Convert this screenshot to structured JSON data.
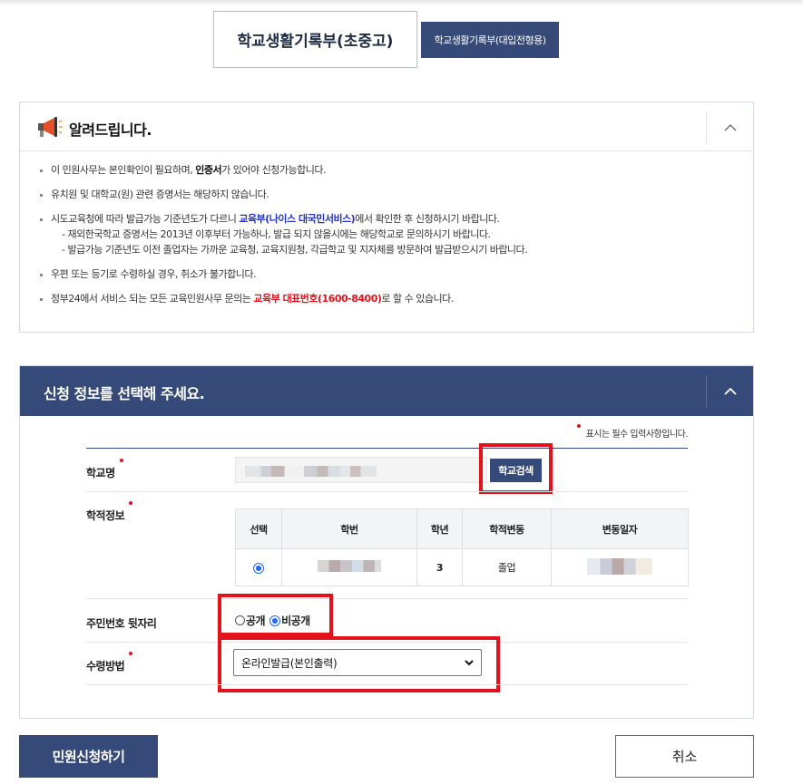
{
  "tabs": {
    "active": "학교생활기록부(초중고)",
    "inactive": "학교생활기록부(대입전형용)"
  },
  "notice": {
    "title": "알려드립니다.",
    "items": [
      {
        "pre": "이 민원사무는 본인확인이 필요하며, ",
        "em": "인증서",
        "post": "가 있어야 신청가능합니다."
      },
      {
        "text": "유치원 및 대학교(원) 관련 증명서는 해당하지 않습니다."
      },
      {
        "pre": "시도교육청에 따라 발급가능 기준년도가 다르니 ",
        "em": "교육부(나이스 대국민서비스)",
        "post": "에서 확인한 후 신청하시기 바랍니다.",
        "sub1": "- 재외한국학교 증명서는 2013년 이후부터 가능하나, 발급 되지 않을시에는 해당학교로 문의하시기 바랍니다.",
        "sub2": "- 발급가능 기준년도 이전 졸업자는 가까운 교육청, 교육지원청, 각급학교 및 지자체를 방문하여 발급받으시기 바랍니다."
      },
      {
        "text": "우편 또는 등기로 수령하실 경우, 취소가 불가합니다."
      },
      {
        "pre": "정부24에서 서비스 되는 모든 교육민원사무 문의는 ",
        "em": "교육부 대표번호(1600-8400)",
        "post": "로 할 수 있습니다."
      }
    ]
  },
  "form": {
    "title": "신청 정보를 선택해 주세요.",
    "required_note": "표시는 필수 입력사항입니다.",
    "school_label": "학교명",
    "school_search_button": "학교검색",
    "record_label": "학적정보",
    "table": {
      "headers": [
        "선택",
        "학번",
        "학년",
        "학적변동",
        "변동일자"
      ],
      "rows": [
        {
          "grade": "3",
          "status": "졸업"
        }
      ]
    },
    "resident_label": "주민번호 뒷자리",
    "resident_options": {
      "public": "공개",
      "private": "비공개",
      "selected": "private"
    },
    "receive_label": "수령방법",
    "receive_value": "온라인발급(본인출력)"
  },
  "buttons": {
    "submit": "민원신청하기",
    "cancel": "취소"
  },
  "colors": {
    "navy": "#364a7a",
    "highlight": "#e3121b",
    "link_blue": "#2233cc"
  }
}
